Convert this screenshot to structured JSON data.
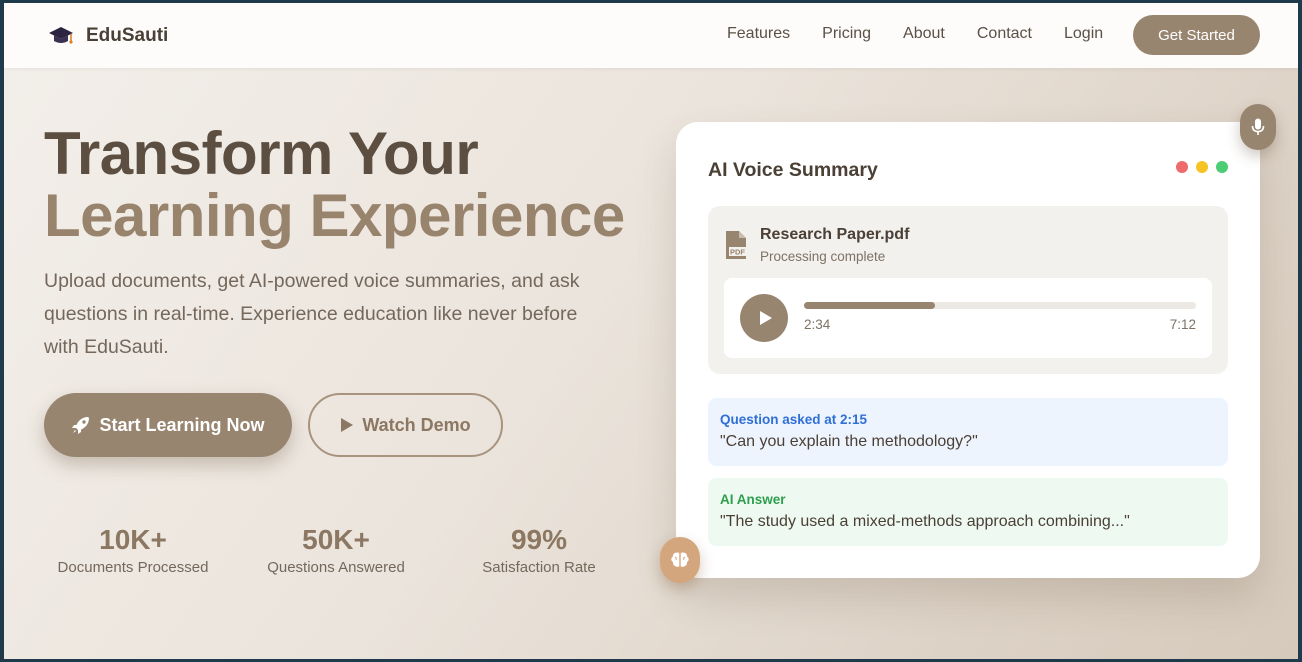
{
  "brand": {
    "name": "EduSauti",
    "icon": "graduation-cap-icon"
  },
  "nav": {
    "links": [
      "Features",
      "Pricing",
      "About",
      "Contact",
      "Login"
    ],
    "cta": "Get Started"
  },
  "hero": {
    "title_line1": "Transform Your",
    "title_line2": "Learning Experience",
    "subtitle": "Upload documents, get AI-powered voice summaries, and ask questions in real-time. Experience education like never before with EduSauti.",
    "primary_button": "Start Learning Now",
    "primary_icon": "rocket-icon",
    "secondary_button": "Watch Demo",
    "secondary_icon": "play-icon"
  },
  "stats": [
    {
      "value": "10K+",
      "label": "Documents Processed"
    },
    {
      "value": "50K+",
      "label": "Questions Answered"
    },
    {
      "value": "99%",
      "label": "Satisfaction Rate"
    }
  ],
  "card": {
    "title": "AI Voice Summary",
    "window_dots": [
      "#ef6b6b",
      "#f5c324",
      "#4ccd74"
    ],
    "file": {
      "name": "Research Paper.pdf",
      "status": "Processing complete",
      "icon": "pdf-file-icon"
    },
    "player": {
      "current_time": "2:34",
      "total_time": "7:12",
      "progress_fraction": 0.335
    },
    "question": {
      "label": "Question asked at 2:15",
      "text": "\"Can you explain the methodology?\"",
      "color": "#2f6fd6"
    },
    "answer": {
      "label": "AI Answer",
      "text": "\"The study used a mixed-methods approach combining...\"",
      "color": "#2e9e4f"
    }
  },
  "floating": {
    "top_icon": "microphone-icon",
    "bottom_icon": "brain-icon"
  },
  "colors": {
    "accent": "#988570",
    "title_dark": "#5c4f42",
    "brain_badge": "#d4a67d"
  }
}
